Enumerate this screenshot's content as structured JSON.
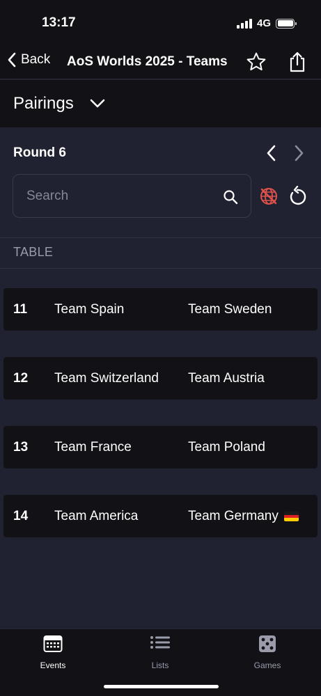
{
  "status": {
    "time": "13:17",
    "network": "4G"
  },
  "nav": {
    "back_label": "Back",
    "title": "AoS Worlds 2025 - Teams",
    "star_icon": "star-outline-icon",
    "share_icon": "share-icon"
  },
  "pairings": {
    "label": "Pairings",
    "dropdown_icon": "chevron-down-icon"
  },
  "round": {
    "label": "Round 6",
    "prev_icon": "chevron-left-icon",
    "next_icon": "chevron-right-icon"
  },
  "search": {
    "placeholder": "Search",
    "value": ""
  },
  "table_header": "TABLE",
  "pairings_list": [
    {
      "table": "11",
      "team_a": "Team Spain",
      "team_b": "Team Sweden",
      "flag_b": ""
    },
    {
      "table": "12",
      "team_a": "Team Switzerland",
      "team_b": "Team Austria",
      "flag_b": ""
    },
    {
      "table": "13",
      "team_a": "Team France",
      "team_b": "Team Poland",
      "flag_b": ""
    },
    {
      "table": "14",
      "team_a": "Team America",
      "team_b": "Team Germany",
      "flag_b": "germany-flag"
    }
  ],
  "tabs": [
    {
      "label": "Events",
      "icon": "calendar-icon",
      "active": true
    },
    {
      "label": "Lists",
      "icon": "list-icon",
      "active": false
    },
    {
      "label": "Games",
      "icon": "dice-icon",
      "active": false
    }
  ],
  "colors": {
    "background": "#212231",
    "surface": "#111116",
    "accent_muted": "#9a9cab",
    "globe_icon": "#e0524c"
  }
}
